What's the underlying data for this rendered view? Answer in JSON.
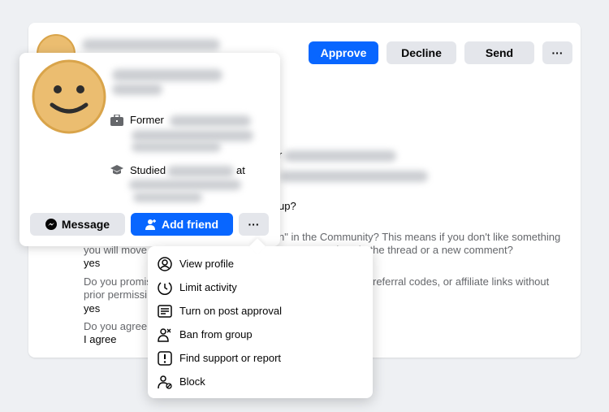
{
  "actions": {
    "approve": "Approve",
    "decline": "Decline",
    "send": "Send",
    "more": "···"
  },
  "answers": {
    "q_fragment_1": "r",
    "q_fragment_2": "up?",
    "q3_line1": "n\" in the Community? This means if you don't like something",
    "q3_line2a": "you will move",
    "q3_line2b": "actions in the thread or a new comment?",
    "a3": "yes",
    "q4_line1a": "Do you promis",
    "q4_line1b": "referral codes, or affiliate links without",
    "q4_line2": "prior permissi",
    "a4": "yes",
    "q5": "Do you agree",
    "a5": "I agree"
  },
  "hover_card": {
    "work_prefix": "Former",
    "education_prefix": "Studied",
    "education_mid": "at",
    "message": "Message",
    "add_friend": "Add friend",
    "more": "···"
  },
  "menu": {
    "items": [
      {
        "label": "View profile",
        "icon": "user-circle-icon"
      },
      {
        "label": "Limit activity",
        "icon": "clock-limit-icon"
      },
      {
        "label": "Turn on post approval",
        "icon": "post-approval-icon"
      },
      {
        "label": "Ban from group",
        "icon": "ban-user-icon"
      },
      {
        "label": "Find support or report",
        "icon": "report-icon"
      },
      {
        "label": "Block",
        "icon": "block-user-icon"
      }
    ]
  },
  "colors": {
    "primary": "#0866ff",
    "avatar": "#ebbd70",
    "avatar_border": "#d9a44a"
  }
}
